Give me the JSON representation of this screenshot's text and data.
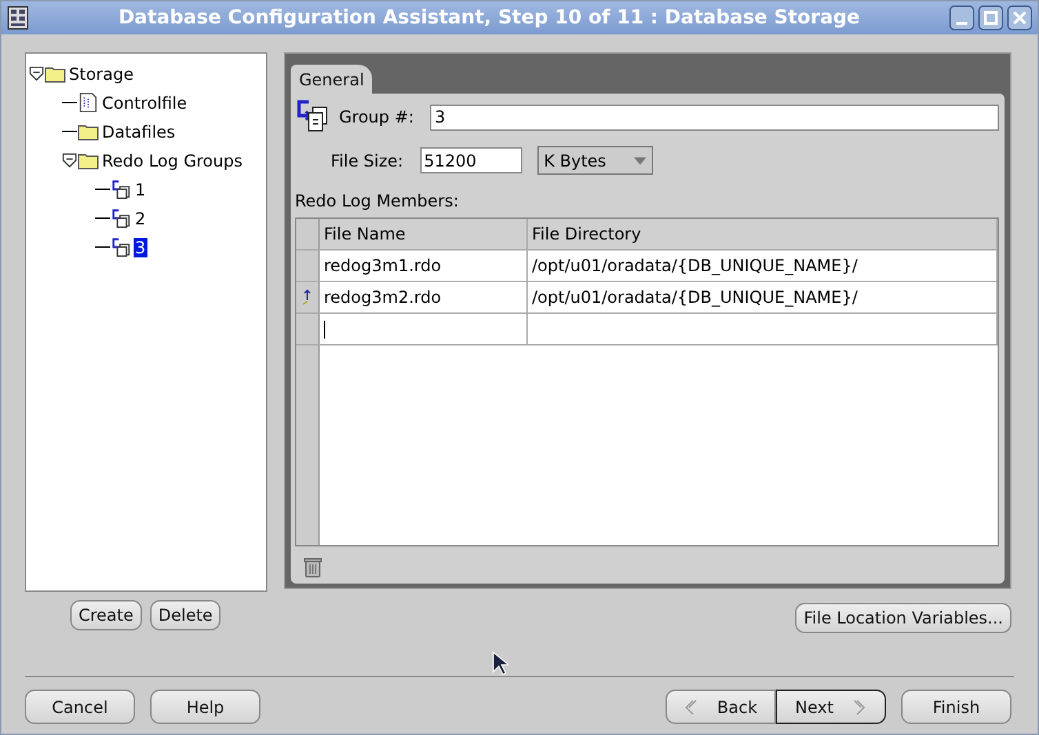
{
  "window": {
    "title": "Database Configuration Assistant, Step 10 of 11 : Database Storage"
  },
  "tree": [
    {
      "label": "Storage",
      "kind": "folder",
      "expanded": true,
      "selected": false,
      "children": [
        {
          "label": "Controlfile",
          "kind": "file",
          "selected": false
        },
        {
          "label": "Datafiles",
          "kind": "folder",
          "selected": false
        },
        {
          "label": "Redo Log Groups",
          "kind": "folder",
          "expanded": true,
          "selected": false,
          "children": [
            {
              "label": "1",
              "kind": "group",
              "selected": false
            },
            {
              "label": "2",
              "kind": "group",
              "selected": false
            },
            {
              "label": "3",
              "kind": "group",
              "selected": true
            }
          ]
        }
      ]
    }
  ],
  "tree_buttons": [
    "Create",
    "Delete"
  ],
  "tabs": [
    {
      "label": "General",
      "selected": true
    }
  ],
  "group": {
    "label": "Group #:",
    "value": "3"
  },
  "file_size": {
    "label": "File Size:",
    "value": "51200",
    "unit": "K Bytes"
  },
  "members": {
    "label": "Redo Log Members:",
    "columns": [
      "File Name",
      "File Directory"
    ],
    "rows": [
      {
        "kind": "file",
        "current": false,
        "cells": [
          "redog3m1.rdo",
          "/opt/u01/oradata/{DB_UNIQUE_NAME}/"
        ]
      },
      {
        "kind": "file",
        "current": true,
        "cells": [
          "redog3m2.rdo",
          "/opt/u01/oradata/{DB_UNIQUE_NAME}/"
        ]
      },
      {
        "kind": "new",
        "current": false,
        "cells": []
      }
    ]
  },
  "file_location_button": "File Location Variables...",
  "footer": {
    "left": [
      "Cancel",
      "Help"
    ],
    "back": "Back",
    "next": "Next",
    "finish": "Finish"
  }
}
